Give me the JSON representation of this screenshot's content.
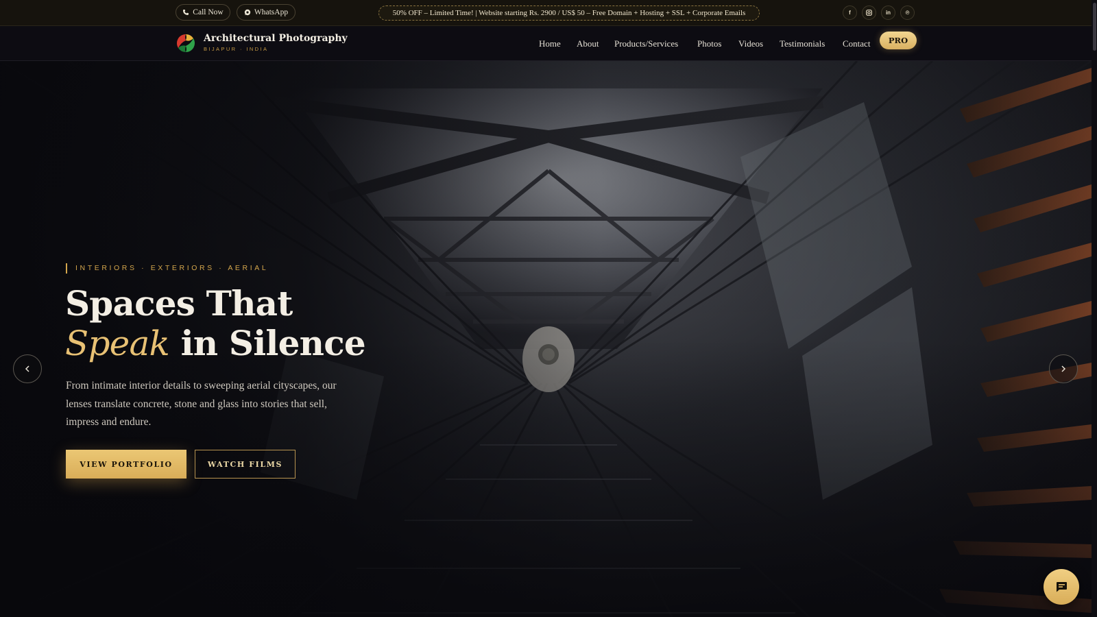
{
  "topbar": {
    "call_label": "Call Now",
    "whatsapp_label": "WhatsApp",
    "promo": "50% OFF – Limited Time! | Website starting Rs. 2900 / US$ 50 – Free Domain + Hosting + SSL + Corporate Emails",
    "social": [
      {
        "icon": "facebook-icon",
        "glyph": "f"
      },
      {
        "icon": "instagram-icon",
        "glyph": "◘"
      },
      {
        "icon": "linkedin-icon",
        "glyph": "in"
      },
      {
        "icon": "pinterest-icon",
        "glyph": "℗"
      }
    ]
  },
  "nav": {
    "brand": "Architectural Photography",
    "location": "BIJAPUR · INDIA",
    "items": [
      "Home",
      "About",
      "Products/Services",
      "Photos",
      "Videos",
      "Testimonials",
      "Contact"
    ],
    "pro_label": "PRO"
  },
  "hero": {
    "eyebrow": "INTERIORS · EXTERIORS · AERIAL",
    "headline_line1": "Spaces That",
    "headline_accent": "Speak",
    "headline_rest": " in Silence",
    "description": "From intimate interior details to sweeping aerial cityscapes, our lenses translate concrete, stone and glass into stories that sell, impress and endure.",
    "primary_button": "VIEW PORTFOLIO",
    "secondary_button": "WATCH FILMS"
  },
  "colors": {
    "accent_gold": "#d9ad58",
    "background": "#0b0a10",
    "topbar": "#16130d"
  },
  "icons": {
    "call": "phone-icon",
    "whatsapp": "whatsapp-icon",
    "prev": "chevron-left-icon",
    "next": "chevron-right-icon",
    "chat": "chat-icon"
  }
}
